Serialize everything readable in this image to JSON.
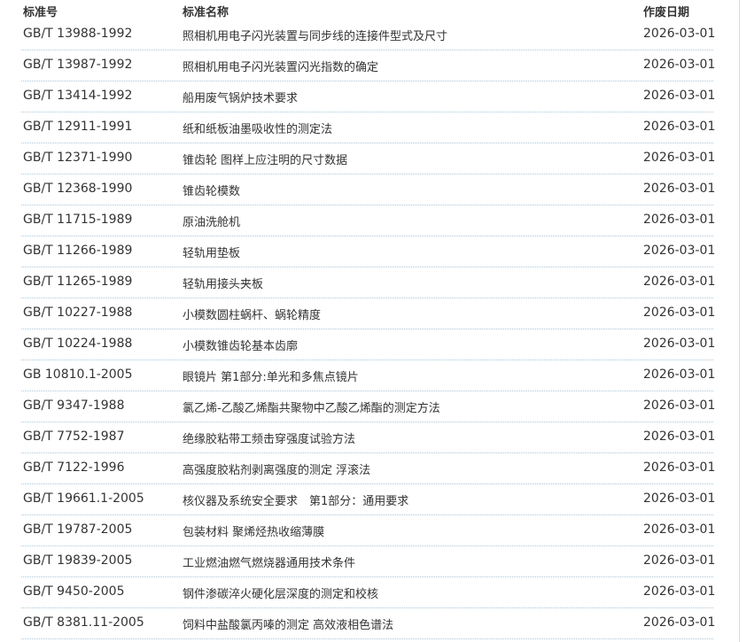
{
  "header": {
    "code_label": "标准号",
    "name_label": "标准名称",
    "date_label": "作废日期"
  },
  "rows": [
    {
      "code": "GB/T 13988-1992",
      "name": "照相机用电子闪光装置与同步线的连接件型式及尺寸",
      "date": "2026-03-01"
    },
    {
      "code": "GB/T 13987-1992",
      "name": "照相机用电子闪光装置闪光指数的确定",
      "date": "2026-03-01"
    },
    {
      "code": "GB/T 13414-1992",
      "name": "船用废气锅炉技术要求",
      "date": "2026-03-01"
    },
    {
      "code": "GB/T 12911-1991",
      "name": "纸和纸板油墨吸收性的测定法",
      "date": "2026-03-01"
    },
    {
      "code": "GB/T 12371-1990",
      "name": "锥齿轮 图样上应注明的尺寸数据",
      "date": "2026-03-01"
    },
    {
      "code": "GB/T 12368-1990",
      "name": "锥齿轮模数",
      "date": "2026-03-01"
    },
    {
      "code": "GB/T 11715-1989",
      "name": "原油洗舱机",
      "date": "2026-03-01"
    },
    {
      "code": "GB/T 11266-1989",
      "name": "轻轨用垫板",
      "date": "2026-03-01"
    },
    {
      "code": "GB/T 11265-1989",
      "name": "轻轨用接头夹板",
      "date": "2026-03-01"
    },
    {
      "code": "GB/T 10227-1988",
      "name": "小模数圆柱蜗杆、蜗轮精度",
      "date": "2026-03-01"
    },
    {
      "code": "GB/T 10224-1988",
      "name": "小模数锥齿轮基本齿廓",
      "date": "2026-03-01"
    },
    {
      "code": "GB 10810.1-2005",
      "name": "眼镜片 第1部分:单光和多焦点镜片",
      "date": "2026-03-01"
    },
    {
      "code": "GB/T 9347-1988",
      "name": "氯乙烯-乙酸乙烯酯共聚物中乙酸乙烯酯的测定方法",
      "date": "2026-03-01"
    },
    {
      "code": "GB/T 7752-1987",
      "name": "绝缘胶粘带工频击穿强度试验方法",
      "date": "2026-03-01"
    },
    {
      "code": "GB/T 7122-1996",
      "name": "高强度胶粘剂剥离强度的测定 浮滚法",
      "date": "2026-03-01"
    },
    {
      "code": "GB/T 19661.1-2005",
      "name": "核仪器及系统安全要求　第1部分：通用要求",
      "date": "2026-03-01"
    },
    {
      "code": "GB/T 19787-2005",
      "name": "包装材料 聚烯烃热收缩薄膜",
      "date": "2026-03-01"
    },
    {
      "code": "GB/T 19839-2005",
      "name": "工业燃油燃气燃烧器通用技术条件",
      "date": "2026-03-01"
    },
    {
      "code": "GB/T 9450-2005",
      "name": "钢件渗碳淬火硬化层深度的测定和校核",
      "date": "2026-03-01"
    },
    {
      "code": "GB/T 8381.11-2005",
      "name": "饲料中盐酸氯丙嗪的测定 高效液相色谱法",
      "date": "2026-03-01"
    }
  ]
}
